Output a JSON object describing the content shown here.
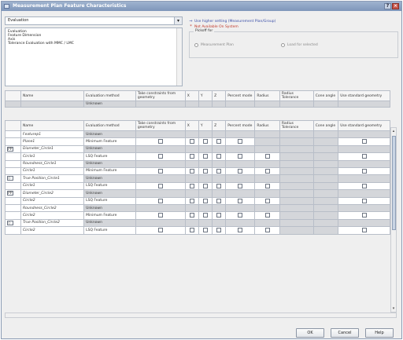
{
  "window": {
    "title": "Measurement Plan Feature Characteristics"
  },
  "selector": {
    "value": "Evaluation"
  },
  "listbox": {
    "items": [
      "Evaluation",
      "Feature Dimension",
      "Axis",
      "Tolerance Evaluation with MMC / LMC"
    ]
  },
  "options": {
    "opt1": "Use higher setting (Measurement Plan/Group)",
    "opt2": "Not Available On System"
  },
  "groupbox": {
    "legend": "Pickoff for",
    "radio1": "Measurement Plan",
    "radio2": "Load for selected"
  },
  "columns": [
    "",
    "Name",
    "Evaluation method",
    "Take constraints from geometry",
    "X",
    "Y",
    "Z",
    "Percent mode",
    "Radius",
    "Radius Tolerance",
    "Cone angle",
    "Use standard geometry"
  ],
  "top_table": {
    "rows": [
      {
        "name": "",
        "method": "Unknown"
      }
    ]
  },
  "main_table": {
    "rows": [
      {
        "icon": "",
        "name": "Featurep1",
        "method": "Unknown",
        "cbs": [
          0,
          0,
          0,
          0,
          0,
          0,
          0,
          0
        ]
      },
      {
        "icon": "",
        "name": "Plane1",
        "method": "Minimum Feature",
        "cbs": [
          1,
          1,
          1,
          1,
          1,
          0,
          0,
          1
        ]
      },
      {
        "icon": "PP",
        "name": "Diameter_Circle1",
        "method": "Unknown",
        "cbs": [
          0,
          0,
          0,
          0,
          0,
          0,
          0,
          0
        ]
      },
      {
        "icon": "",
        "name": "Circle1",
        "method": "LSQ Feature",
        "cbs": [
          1,
          1,
          1,
          1,
          1,
          1,
          0,
          1
        ]
      },
      {
        "icon": "",
        "name": "Roundness_Circle1",
        "method": "Unknown",
        "cbs": [
          0,
          0,
          0,
          0,
          0,
          0,
          0,
          0
        ]
      },
      {
        "icon": "",
        "name": "Circle1",
        "method": "Minimum Feature",
        "cbs": [
          1,
          1,
          1,
          1,
          1,
          1,
          0,
          1
        ]
      },
      {
        "icon": "◇",
        "name": "True Position_Circle1",
        "method": "Unknown",
        "cbs": [
          0,
          0,
          0,
          0,
          0,
          0,
          0,
          0
        ]
      },
      {
        "icon": "",
        "name": "Circle1",
        "method": "LSQ Feature",
        "cbs": [
          1,
          1,
          1,
          1,
          1,
          1,
          0,
          1
        ]
      },
      {
        "icon": "PP",
        "name": "Diameter_Circle2",
        "method": "Unknown",
        "cbs": [
          0,
          0,
          0,
          0,
          0,
          0,
          0,
          0
        ]
      },
      {
        "icon": "",
        "name": "Circle2",
        "method": "LSQ Feature",
        "cbs": [
          1,
          1,
          1,
          1,
          1,
          1,
          0,
          1
        ]
      },
      {
        "icon": "",
        "name": "Roundness_Circle2",
        "method": "Unknown",
        "cbs": [
          0,
          0,
          0,
          0,
          0,
          0,
          0,
          0
        ]
      },
      {
        "icon": "",
        "name": "Circle2",
        "method": "Minimum Feature",
        "cbs": [
          1,
          1,
          1,
          1,
          1,
          1,
          0,
          1
        ]
      },
      {
        "icon": "◇",
        "name": "True Position_Circle2",
        "method": "Unknown",
        "cbs": [
          0,
          0,
          0,
          0,
          0,
          0,
          0,
          0
        ]
      },
      {
        "icon": "",
        "name": "Circle2",
        "method": "LSQ Feature",
        "cbs": [
          1,
          1,
          1,
          1,
          1,
          1,
          0,
          1
        ]
      }
    ]
  },
  "buttons": {
    "ok": "OK",
    "cancel": "Cancel",
    "help": "Help"
  },
  "colors": {
    "titlebar": "#7e96ba",
    "option1": "#3b4fa8",
    "option2": "#c0392b",
    "disabled": "#d4d6da"
  }
}
